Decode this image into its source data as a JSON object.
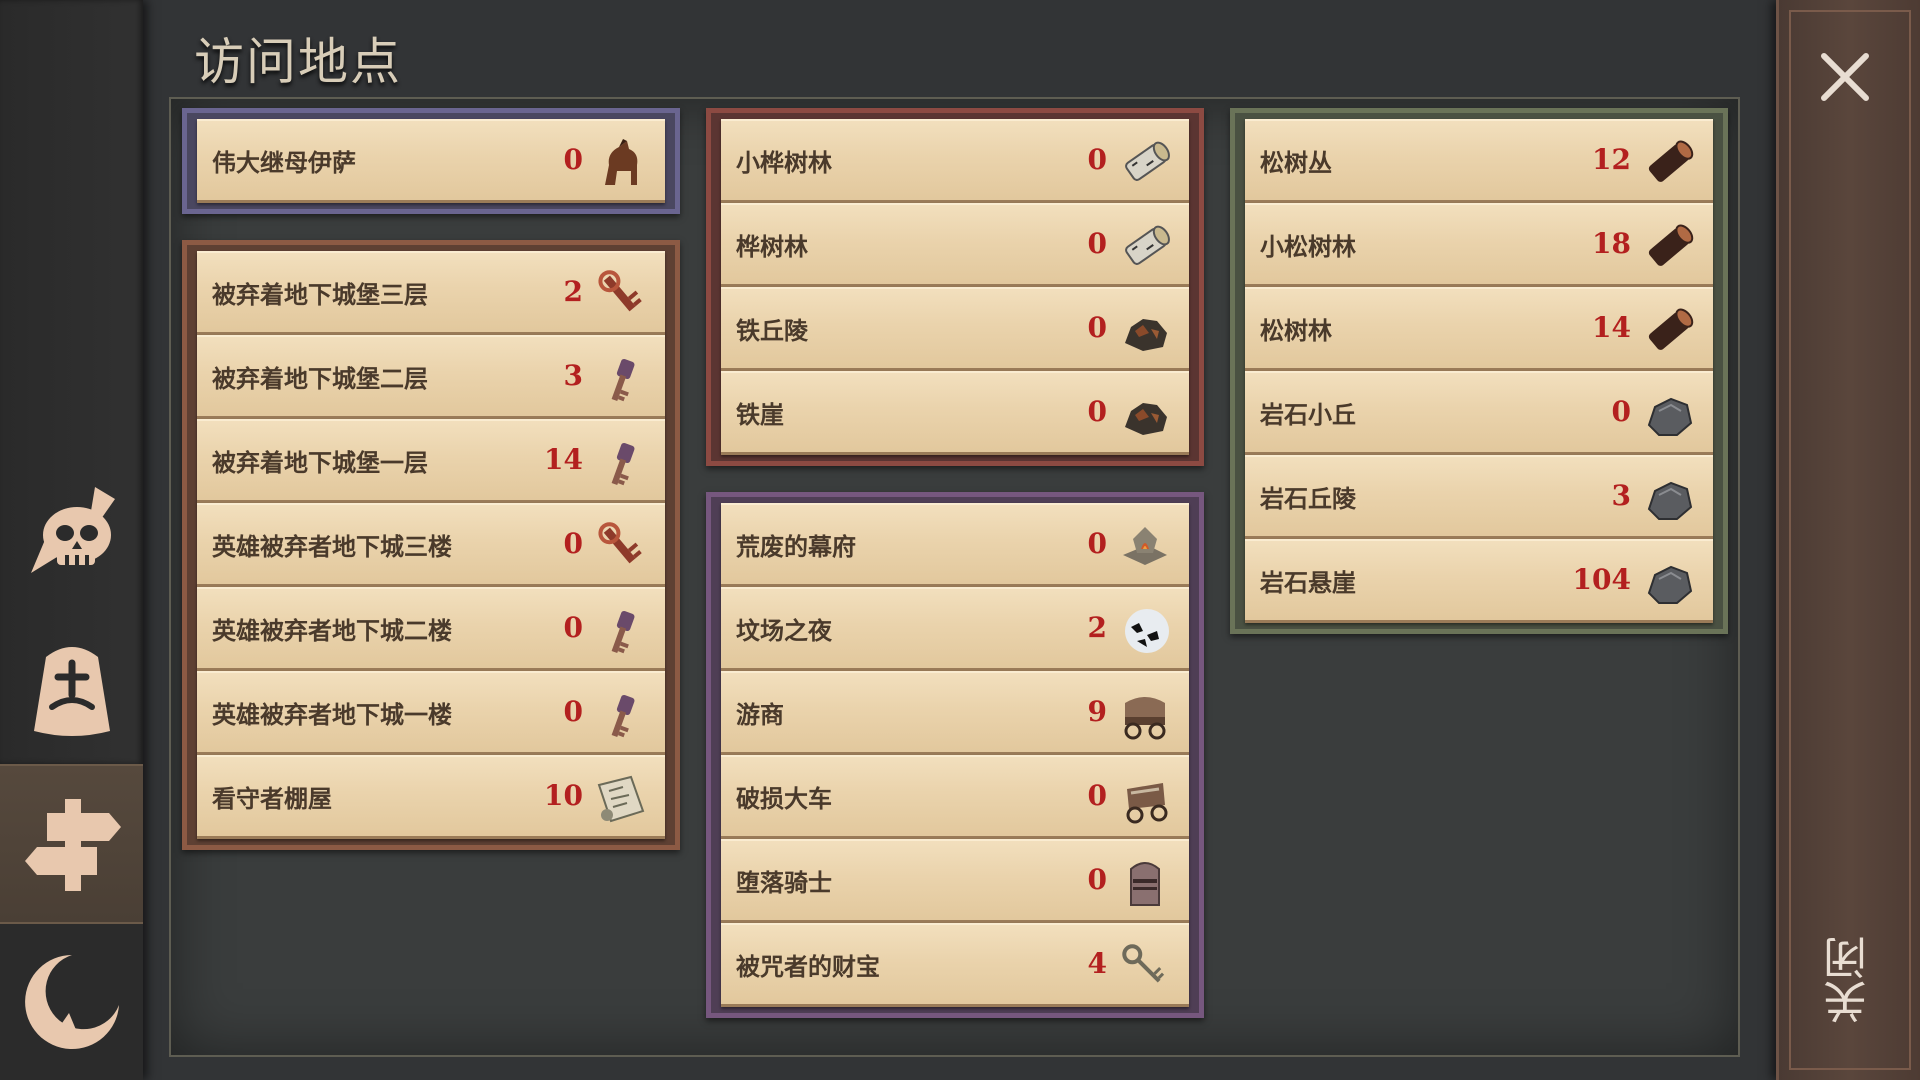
{
  "title": "访问地点",
  "close": {
    "label": "关闭",
    "x_icon": "close-icon"
  },
  "nav": [
    {
      "icon": "skull-crossbones-icon",
      "active": false
    },
    {
      "icon": "crossed-stone-icon",
      "active": false
    },
    {
      "icon": "signpost-icon",
      "active": true
    },
    {
      "icon": "crescent-moon-icon",
      "active": false
    }
  ],
  "groups": {
    "g1": {
      "color": "blue",
      "items": [
        {
          "name": "伟大继母伊萨",
          "count": "0",
          "icon": "horse-icon"
        }
      ]
    },
    "g2": {
      "color": "brown",
      "items": [
        {
          "name": "被弃着地下城堡三层",
          "count": "2",
          "icon": "red-key-icon"
        },
        {
          "name": "被弃着地下城堡二层",
          "count": "3",
          "icon": "purple-key-icon"
        },
        {
          "name": "被弃着地下城堡一层",
          "count": "14",
          "icon": "purple-key-icon"
        },
        {
          "name": "英雄被弃者地下城三楼",
          "count": "0",
          "icon": "red-key-icon"
        },
        {
          "name": "英雄被弃者地下城二楼",
          "count": "0",
          "icon": "purple-key-icon"
        },
        {
          "name": "英雄被弃者地下城一楼",
          "count": "0",
          "icon": "purple-key-icon"
        },
        {
          "name": "看守者棚屋",
          "count": "10",
          "icon": "map-scroll-icon"
        }
      ]
    },
    "g3": {
      "color": "red",
      "items": [
        {
          "name": "小桦树林",
          "count": "0",
          "icon": "birch-log-icon"
        },
        {
          "name": "桦树林",
          "count": "0",
          "icon": "birch-log-icon"
        },
        {
          "name": "铁丘陵",
          "count": "0",
          "icon": "iron-ore-icon"
        },
        {
          "name": "铁崖",
          "count": "0",
          "icon": "iron-ore-icon"
        }
      ]
    },
    "g4": {
      "color": "purple",
      "items": [
        {
          "name": "荒废的幕府",
          "count": "0",
          "icon": "campfire-icon"
        },
        {
          "name": "坟场之夜",
          "count": "2",
          "icon": "crows-moon-icon"
        },
        {
          "name": "游商",
          "count": "9",
          "icon": "merchant-wagon-icon"
        },
        {
          "name": "破损大车",
          "count": "0",
          "icon": "broken-cart-icon"
        },
        {
          "name": "堕落骑士",
          "count": "0",
          "icon": "knight-helmet-icon"
        },
        {
          "name": "被咒者的财宝",
          "count": "4",
          "icon": "key-icon"
        }
      ]
    },
    "g5": {
      "color": "green",
      "items": [
        {
          "name": "松树丛",
          "count": "12",
          "icon": "pine-log-icon"
        },
        {
          "name": "小松树林",
          "count": "18",
          "icon": "pine-log-icon"
        },
        {
          "name": "松树林",
          "count": "14",
          "icon": "pine-log-icon"
        },
        {
          "name": "岩石小丘",
          "count": "0",
          "icon": "stone-icon"
        },
        {
          "name": "岩石丘陵",
          "count": "3",
          "icon": "stone-icon"
        },
        {
          "name": "岩石悬崖",
          "count": "104",
          "icon": "stone-icon"
        }
      ]
    }
  }
}
